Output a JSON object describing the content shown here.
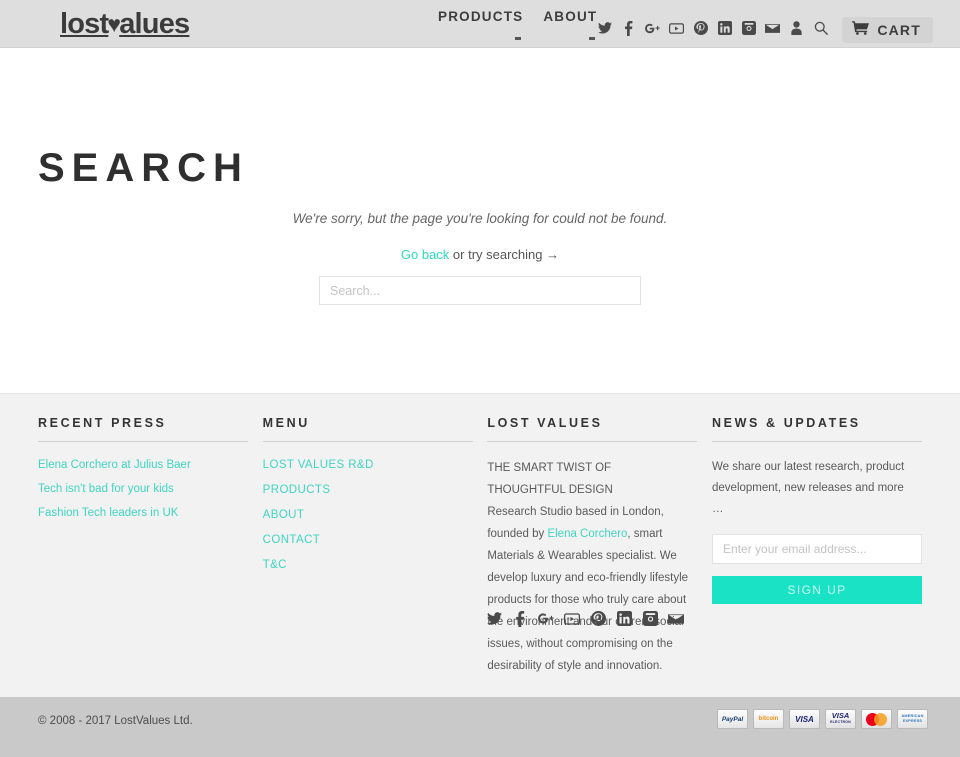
{
  "header": {
    "logo_pre": "lost",
    "logo_heart": "♥",
    "logo_post": "alues",
    "nav": [
      {
        "label": "PRODUCTS",
        "has_dropdown": true
      },
      {
        "label": "ABOUT",
        "has_dropdown": true
      }
    ],
    "social": [
      {
        "name": "twitter-icon"
      },
      {
        "name": "facebook-icon"
      },
      {
        "name": "google-plus-icon"
      },
      {
        "name": "youtube-icon"
      },
      {
        "name": "pinterest-icon"
      },
      {
        "name": "linkedin-icon"
      },
      {
        "name": "instagram-icon"
      },
      {
        "name": "email-icon"
      },
      {
        "name": "account-icon"
      },
      {
        "name": "search-icon"
      }
    ],
    "cart_label": "CART"
  },
  "main": {
    "title": "SEARCH",
    "not_found": "We're sorry, but the page you're looking for could not be found.",
    "go_back_label": "Go back",
    "try_searching": " or try searching →",
    "search_placeholder": "Search...",
    "search_value": ""
  },
  "footer": {
    "recent_press": {
      "heading": "RECENT PRESS",
      "links": [
        "Elena Corchero at Julius Baer",
        "Tech isn't bad for your kids",
        "Fashion Tech leaders in UK"
      ]
    },
    "menu": {
      "heading": "MENU",
      "links": [
        "LOST VALUES R&D",
        "PRODUCTS",
        "ABOUT",
        "CONTACT",
        "T&C"
      ]
    },
    "lost_values": {
      "heading": "LOST VALUES",
      "tagline_line1": "THE SMART TWIST OF",
      "tagline_line2": "THOUGHTFUL DESIGN",
      "body_part1": "Research Studio based in London, founded by ",
      "body_link": "Elena Corchero",
      "body_part2": ", smart Materials & Wearables specialist. We develop luxury and eco-friendly lifestyle products for those who truly care about the environment and our current social issues, without compromising on the desirability of style and innovation."
    },
    "news": {
      "heading": "NEWS & UPDATES",
      "body": "We share our latest research, product development, new releases and more …",
      "email_placeholder": "Enter your email address...",
      "email_value": "",
      "signup_label": "SIGN UP"
    },
    "social": [
      {
        "name": "twitter-icon"
      },
      {
        "name": "facebook-icon"
      },
      {
        "name": "google-plus-icon"
      },
      {
        "name": "youtube-icon"
      },
      {
        "name": "pinterest-icon"
      },
      {
        "name": "linkedin-icon"
      },
      {
        "name": "instagram-icon"
      },
      {
        "name": "email-icon"
      }
    ]
  },
  "bottom": {
    "copyright": "© 2008 - 2017 LostValues Ltd.",
    "payments": [
      {
        "name": "paypal",
        "label": "PayPal"
      },
      {
        "name": "bitcoin",
        "label": "bitcoin"
      },
      {
        "name": "visa",
        "label": "VISA"
      },
      {
        "name": "visa-electron",
        "label": "VISA",
        "sub": "ELECTRON"
      },
      {
        "name": "mastercard",
        "label": ""
      },
      {
        "name": "american-express",
        "label": "AMERICAN",
        "sub": "EXPRESS"
      }
    ]
  },
  "colors": {
    "accent": "#19e3c4",
    "link": "#3fd5c0",
    "header_bg": "#dedede",
    "footer_bg": "#f2f2f2",
    "bottom_bg": "#c9c9c9"
  }
}
